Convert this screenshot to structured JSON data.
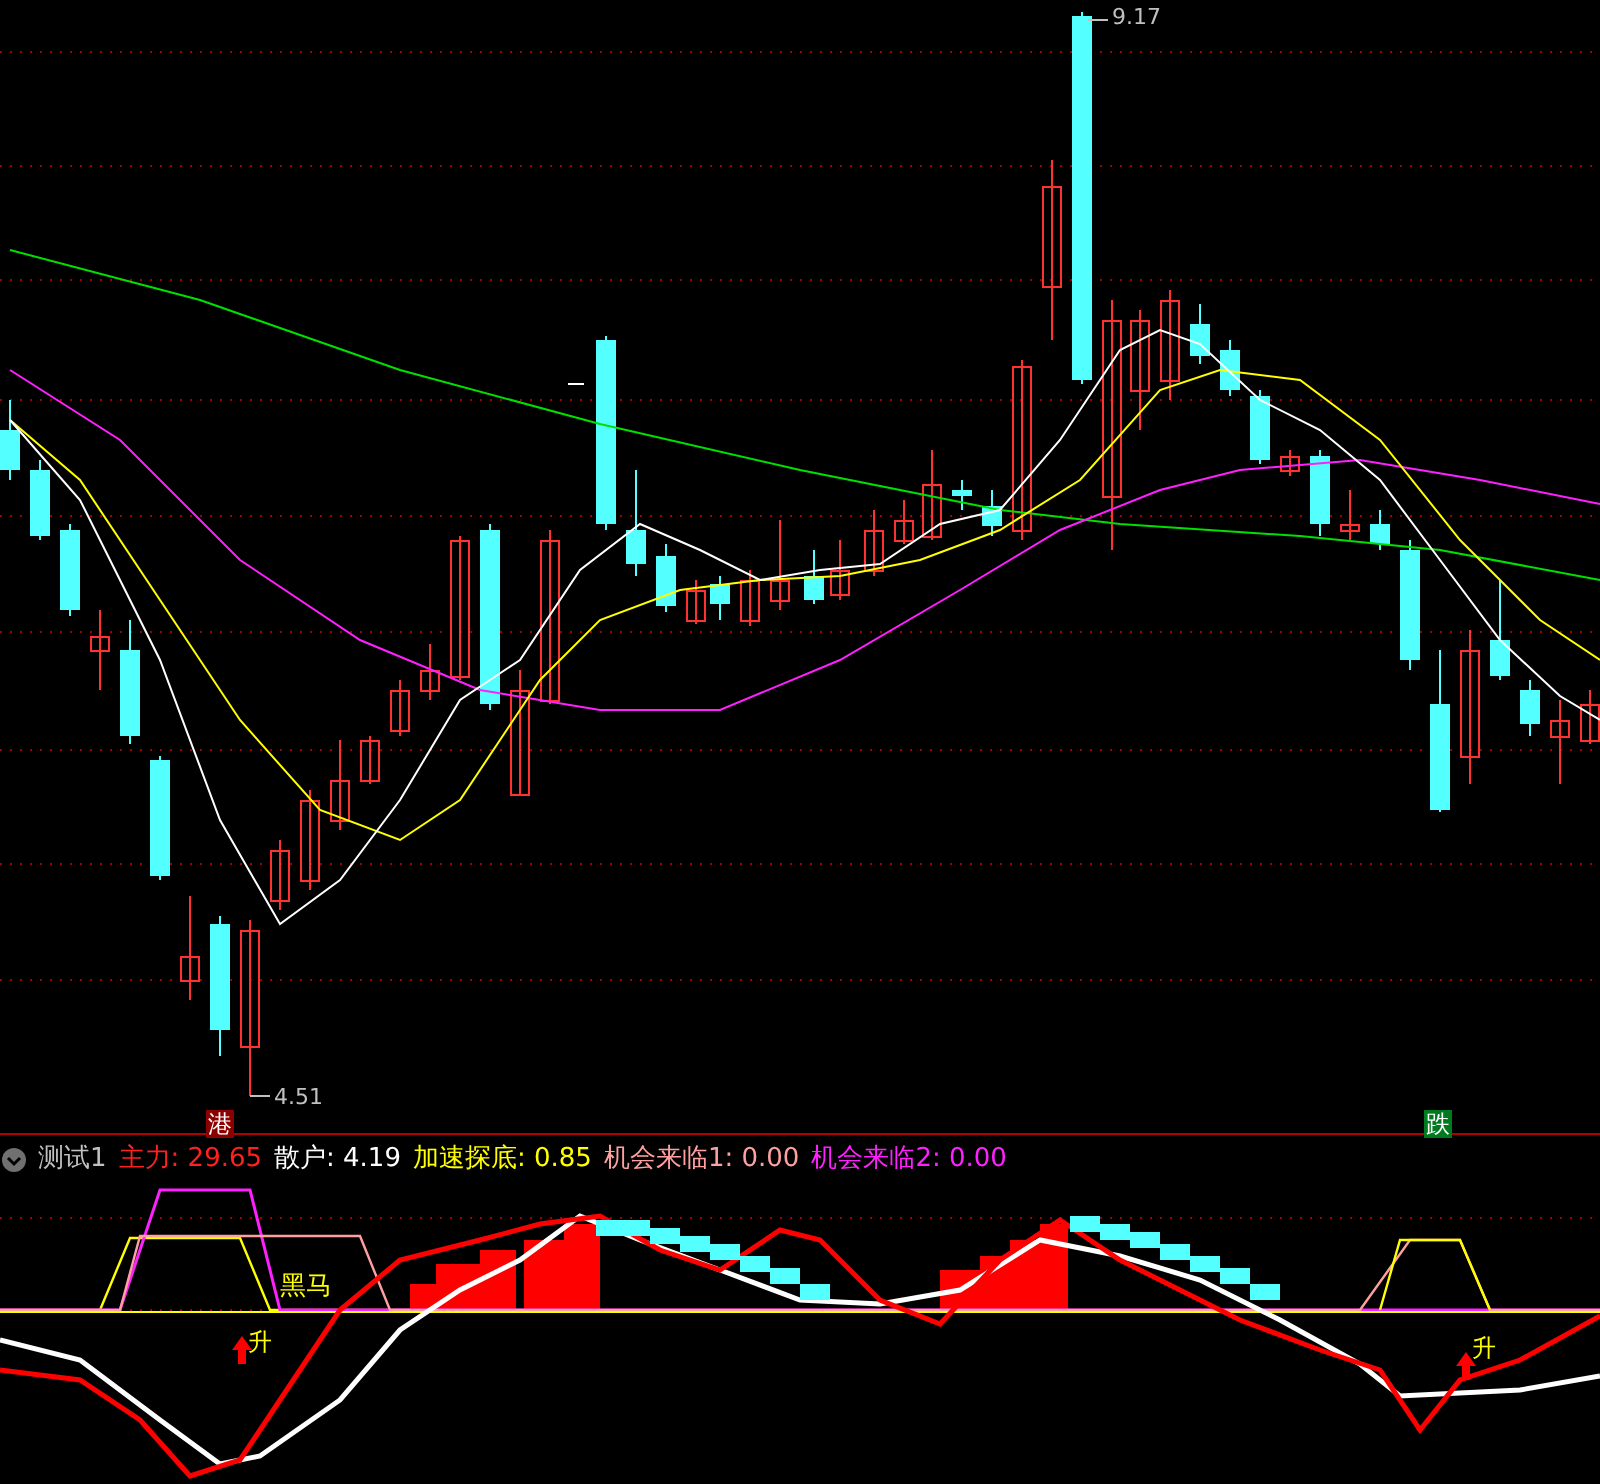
{
  "price_chart": {
    "high_label": "9.17",
    "low_label": "4.51"
  },
  "signals": [
    {
      "text": "港",
      "color": "#8b0000"
    },
    {
      "text": "跌",
      "color": "#007a1e"
    }
  ],
  "indicator": {
    "name": "测试1",
    "values": [
      {
        "label": "主力:",
        "value": "29.65",
        "color": "#ff2020"
      },
      {
        "label": "散户:",
        "value": "4.19",
        "color": "#ffffff"
      },
      {
        "label": "加速探底:",
        "value": "0.85",
        "color": "#ffff00"
      },
      {
        "label": "机会来临1:",
        "value": "0.00",
        "color": "#ffa0a0"
      },
      {
        "label": "机会来临2:",
        "value": "0.00",
        "color": "#ff20ff"
      }
    ]
  },
  "markers": [
    {
      "text": "黑马",
      "kind": "label"
    },
    {
      "text": "升",
      "kind": "up"
    },
    {
      "text": "升",
      "kind": "up"
    }
  ]
}
